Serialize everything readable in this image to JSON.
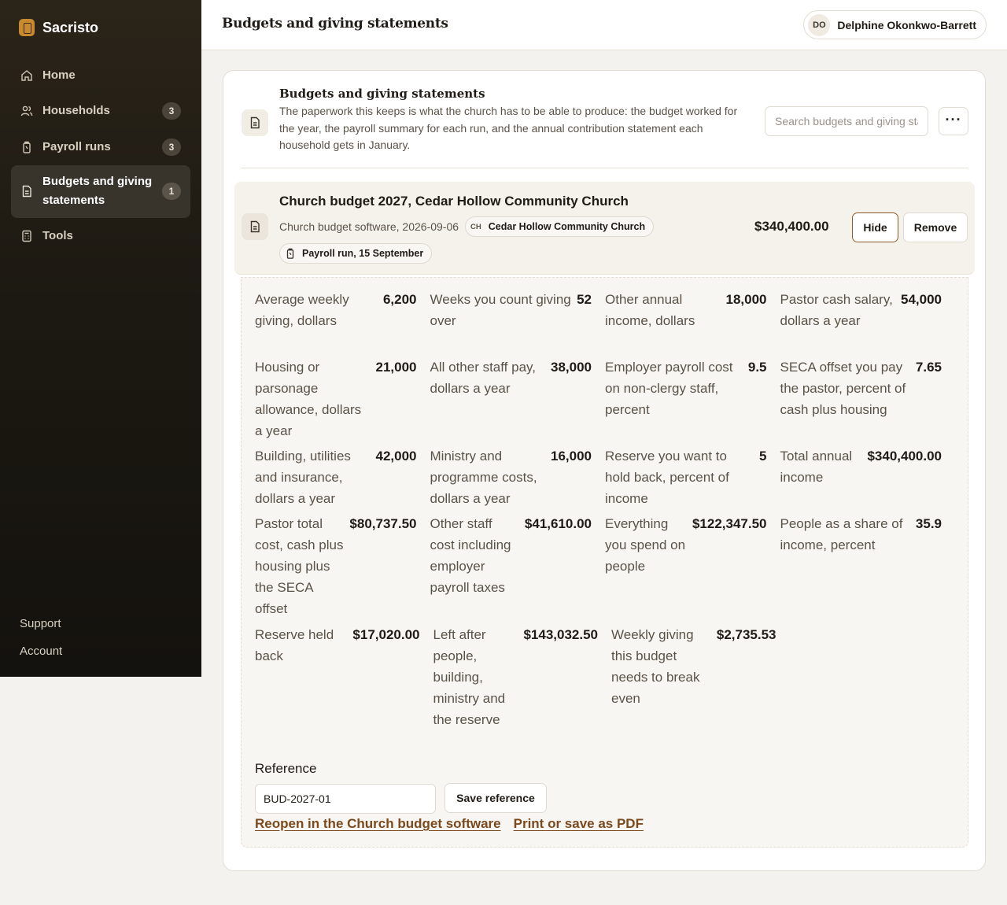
{
  "app": {
    "name": "Sacristo"
  },
  "sidebar": {
    "items": [
      {
        "label": "Home",
        "count": null
      },
      {
        "label": "Households",
        "count": "3"
      },
      {
        "label": "Payroll runs",
        "count": "3"
      },
      {
        "label": "Budgets and giving statements",
        "count": "1",
        "active": true
      },
      {
        "label": "Tools",
        "count": null
      }
    ],
    "bottom": {
      "support": "Support",
      "account": "Account"
    }
  },
  "header": {
    "title": "Budgets and giving statements",
    "user": {
      "initials": "DO",
      "name": "Delphine Okonkwo-Barrett"
    }
  },
  "intro": {
    "title": "Budgets and giving statements",
    "description": "The paperwork this keeps is what the church has to be able to produce: the budget worked for the year, the payroll summary for each run, and the annual contribution statement each household gets in January.",
    "search_placeholder": "Search budgets and giving statements",
    "more_label": "···"
  },
  "entry": {
    "title": "Church budget 2027, Cedar Hollow Community Church",
    "subtitle": "Church budget software, 2026-09-06",
    "org_pill": {
      "initials": "CH",
      "label": "Cedar Hollow Community Church"
    },
    "payroll_pill": "Payroll run, 15 September",
    "amount": "$340,400.00",
    "hide_label": "Hide",
    "remove_label": "Remove"
  },
  "details": {
    "rows": [
      [
        {
          "k": "Average weekly giving, dollars",
          "v": "6,200"
        },
        {
          "k": "Weeks you count giving over",
          "v": "52"
        },
        {
          "k": "Other annual income, dollars",
          "v": "18,000"
        },
        {
          "k": "Pastor cash salary, dollars a year",
          "v": "54,000"
        }
      ],
      [
        {
          "k": "Housing or parsonage allowance, dollars a year",
          "v": "21,000"
        },
        {
          "k": "All other staff pay, dollars a year",
          "v": "38,000"
        },
        {
          "k": "Employer payroll cost on non-clergy staff, percent",
          "v": "9.5"
        },
        {
          "k": "SECA offset you pay the pastor, percent of cash plus housing",
          "v": "7.65"
        }
      ],
      [
        {
          "k": "Building, utilities and insurance, dollars a year",
          "v": "42,000"
        },
        {
          "k": "Ministry and programme costs, dollars a year",
          "v": "16,000"
        },
        {
          "k": "Reserve you want to hold back, percent of income",
          "v": "5"
        },
        {
          "k": "Total annual income",
          "v": "$340,400.00"
        }
      ],
      [
        {
          "k": "Pastor total cost, cash plus housing plus the SECA offset",
          "v": "$80,737.50"
        },
        {
          "k": "Other staff cost including employer payroll taxes",
          "v": "$41,610.00"
        },
        {
          "k": "Everything you spend on people",
          "v": "$122,347.50"
        },
        {
          "k": "People as a share of income, percent",
          "v": "35.9"
        }
      ],
      [
        {
          "k": "Reserve held back",
          "v": "$17,020.00"
        },
        {
          "k": "Left after people, building, ministry and the reserve",
          "v": "$143,032.50"
        },
        {
          "k": "Weekly giving this budget needs to break even",
          "v": "$2,735.53"
        }
      ]
    ],
    "reference_label": "Reference",
    "reference_value": "BUD-2027-01",
    "save_reference_label": "Save reference",
    "reopen_link": "Reopen in the Church budget software",
    "print_link": "Print or save as PDF"
  }
}
